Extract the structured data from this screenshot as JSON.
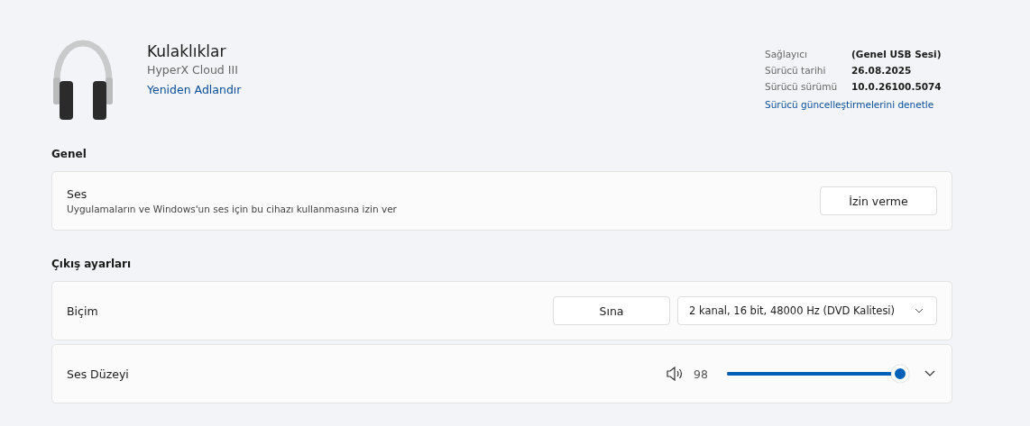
{
  "device": {
    "name": "Kulaklıklar",
    "model": "HyperX Cloud III",
    "rename_link": "Yeniden Adlandır"
  },
  "driver_info": {
    "rows": [
      {
        "label": "Sağlayıcı",
        "value": "(Genel USB Sesi)"
      },
      {
        "label": "Sürücü tarihi",
        "value": "26.08.2025"
      },
      {
        "label": "Sürücü sürümü",
        "value": "10.0.26100.5074"
      }
    ],
    "link": "Sürücü güncelleştirmelerini denetle"
  },
  "sections": [
    {
      "heading": "Genel",
      "cards": [
        {
          "kind": "button",
          "title": "Ses",
          "description": "Uygulamaların ve Windows'un ses için bu cihazı kullanmasına izin ver",
          "button": "İzin verme"
        }
      ]
    },
    {
      "heading": "Çıkış ayarları",
      "cards": [
        {
          "kind": "format",
          "title": "Biçim",
          "button": "Sına",
          "dropdown": "2 kanal, 16 bit, 48000 Hz (DVD Kalitesi)"
        },
        {
          "kind": "volume",
          "title": "Ses Düzeyi",
          "reading": "98",
          "level": 0.98,
          "expanded": false
        }
      ]
    }
  ]
}
